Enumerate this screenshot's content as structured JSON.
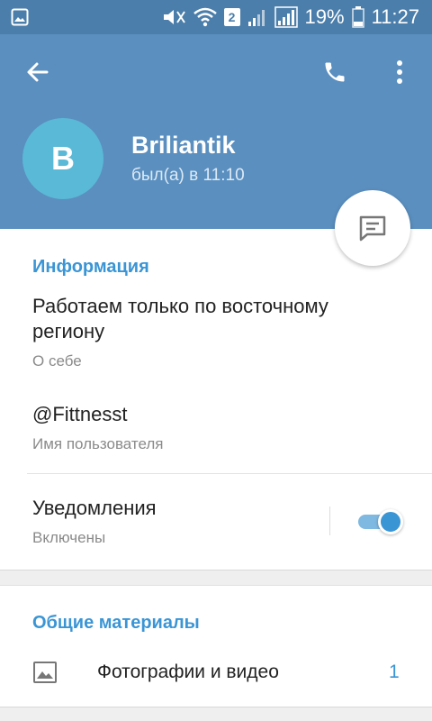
{
  "status_bar": {
    "battery_percent": "19%",
    "time": "11:27",
    "sim_slot": "2"
  },
  "header": {
    "avatar_letter": "B",
    "name": "Briliantik",
    "last_seen": "был(а) в 11:10"
  },
  "info": {
    "section_title": "Информация",
    "bio": "Работаем только по восточному региону",
    "bio_caption": "О себе",
    "username": "@Fittnesst",
    "username_caption": "Имя пользователя",
    "notifications_label": "Уведомления",
    "notifications_state": "Включены",
    "notifications_on": true
  },
  "shared_media": {
    "section_title": "Общие материалы",
    "photos_label": "Фотографии и видео",
    "photos_count": "1"
  },
  "icons": {
    "back": "arrow-left-icon",
    "call": "phone-icon",
    "menu": "more-vertical-icon",
    "message": "message-icon",
    "photos": "image-icon"
  },
  "colors": {
    "header": "#5a8fbf",
    "status_bar": "#4b7eaa",
    "accent": "#3a95d5",
    "avatar": "#5ab9d6"
  }
}
